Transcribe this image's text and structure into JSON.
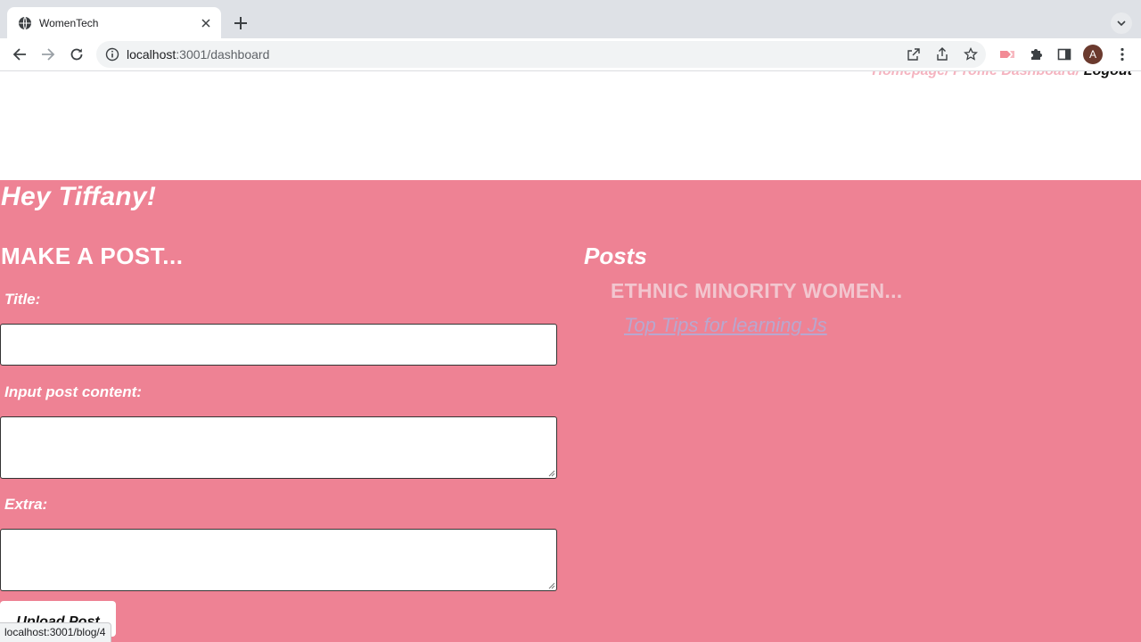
{
  "browser": {
    "tab_title": "WomenTech",
    "url_host": "localhost",
    "url_rest": ":3001/dashboard",
    "avatar_letter": "A",
    "status_url": "localhost:3001/blog/4"
  },
  "nav": {
    "homepage": "Homepage",
    "sep1": "/ ",
    "profile_dashboard": "Profile Dashboard",
    "sep2": "/ ",
    "logout": "Logout"
  },
  "dashboard": {
    "greeting": "Hey Tiffany!",
    "form": {
      "heading": "MAKE A POST...",
      "title_label": "Title:",
      "title_value": "",
      "content_label": "Input post content:",
      "content_value": "",
      "extra_label": "Extra:",
      "extra_value": "",
      "upload_button": "Upload Post"
    },
    "posts": {
      "heading": "Posts",
      "items": [
        {
          "title": "ETHNIC MINORITY WOMEN...",
          "link_text": "Top Tips for learning Js"
        }
      ]
    }
  },
  "colors": {
    "page_pink": "#ee8294",
    "nav_link_pink": "#f5b4c0",
    "post_title": "#f2c6cf",
    "post_link": "#b8a7cf"
  },
  "icons": [
    "globe-icon",
    "close-icon",
    "plus-icon",
    "chevron-down-icon",
    "back-arrow-icon",
    "forward-arrow-icon",
    "reload-icon",
    "info-icon",
    "open-in-new-icon",
    "share-icon",
    "star-icon",
    "extension-ext-icon",
    "puzzle-icon",
    "side-panel-icon",
    "kebab-menu-icon"
  ]
}
